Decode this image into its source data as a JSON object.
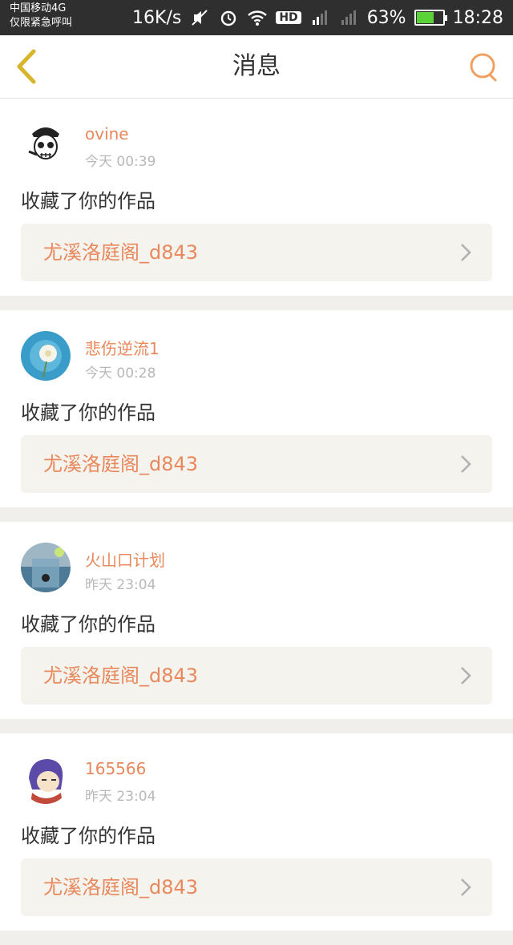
{
  "status_bar": {
    "carrier": "中国移动4G",
    "emergency": "仅限紧急呼叫",
    "speed": "16K/s",
    "network_badge": "HD",
    "lte": "4G",
    "battery": "63%",
    "time": "18:28"
  },
  "nav": {
    "title": "消息",
    "back_icon": "back-chevron-icon",
    "search_icon": "search-icon"
  },
  "colors": {
    "accent": "#e8885c",
    "back": "#d8b52c",
    "search": "#f0a060"
  },
  "messages": [
    {
      "user": "ovine",
      "time": "今天 00:39",
      "action": "收藏了你的作品",
      "work": "尤溪洛庭阁_d843"
    },
    {
      "user": "悲伤逆流1",
      "time": "今天 00:28",
      "action": "收藏了你的作品",
      "work": "尤溪洛庭阁_d843"
    },
    {
      "user": "火山口计划",
      "time": "昨天 23:04",
      "action": "收藏了你的作品",
      "work": "尤溪洛庭阁_d843"
    },
    {
      "user": "165566",
      "time": "昨天 23:04",
      "action": "收藏了你的作品",
      "work": "尤溪洛庭阁_d843"
    }
  ]
}
